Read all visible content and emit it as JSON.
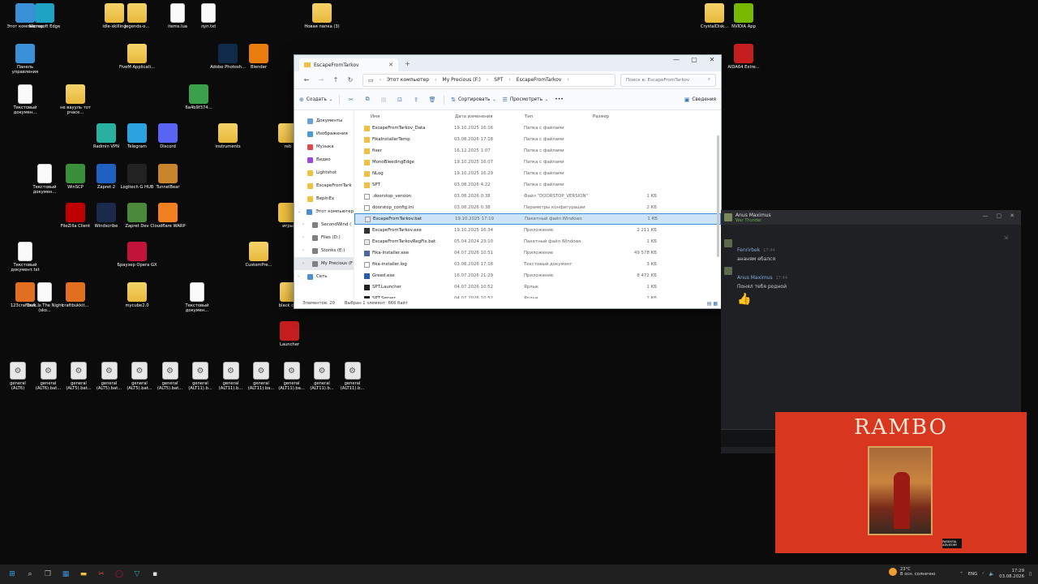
{
  "desktop": {
    "icons": [
      {
        "label": "Этот компьютер",
        "icon": "pc-icon",
        "color": "#3a8fd6",
        "kind": "app"
      },
      {
        "label": "Microsoft Edge",
        "icon": "edge-icon",
        "color": "#1fa3c4",
        "kind": "app"
      },
      {
        "label": "idle-skilling",
        "icon": "folder-icon",
        "color": "#f0c040",
        "kind": "folder"
      },
      {
        "label": "legends-o...",
        "icon": "folder-icon",
        "color": "#f0c040",
        "kind": "folder"
      },
      {
        "label": "items.lua",
        "icon": "document-icon",
        "color": "#ffffff",
        "kind": "doc"
      },
      {
        "label": "луп.txt",
        "icon": "document-icon",
        "color": "#ffffff",
        "kind": "doc"
      },
      {
        "label": "Новая папка (3)",
        "icon": "folder-icon",
        "color": "#f0c040",
        "kind": "folder"
      },
      {
        "label": "CrystalDisk...",
        "icon": "folder-icon",
        "color": "#f0c040",
        "kind": "folder"
      },
      {
        "label": "NVIDIA App",
        "icon": "nvidia-icon",
        "color": "#76b900",
        "kind": "app"
      },
      {
        "label": "Панель управления",
        "icon": "control-panel-icon",
        "color": "#3a8fd6",
        "kind": "app"
      },
      {
        "label": "FiveM Applicati...",
        "icon": "folder-icon",
        "color": "#f0c040",
        "kind": "folder"
      },
      {
        "label": "Adobe Photosh...",
        "icon": "photoshop-icon",
        "color": "#0f2a4a",
        "kind": "app"
      },
      {
        "label": "Blender",
        "icon": "blender-icon",
        "color": "#e87d0d",
        "kind": "app"
      },
      {
        "label": "AIDA64 Extre...",
        "icon": "aida64-icon",
        "color": "#c41e1e",
        "kind": "app"
      },
      {
        "label": "Текстовый докумен...",
        "icon": "document-icon",
        "color": "#ffffff",
        "kind": "doc"
      },
      {
        "label": "не ваууль тот рчасе...",
        "icon": "folder-icon",
        "color": "#f0c040",
        "kind": "folder"
      },
      {
        "label": "6a4b9f374...",
        "icon": "image-icon",
        "color": "#3aa14a",
        "kind": "app"
      },
      {
        "label": "Radmin VPN",
        "icon": "radmin-icon",
        "color": "#2ab0a0",
        "kind": "app"
      },
      {
        "label": "Telegram",
        "icon": "telegram-icon",
        "color": "#2aa3e0",
        "kind": "app"
      },
      {
        "label": "Discord",
        "icon": "discord-icon",
        "color": "#5865f2",
        "kind": "app"
      },
      {
        "label": "instruments",
        "icon": "folder-icon",
        "color": "#f0c040",
        "kind": "folder"
      },
      {
        "label": "Текстовый докумен...",
        "icon": "document-icon",
        "color": "#ffffff",
        "kind": "doc"
      },
      {
        "label": "WinSCP",
        "icon": "winscp-icon",
        "color": "#3a8f3a",
        "kind": "app"
      },
      {
        "label": "Zapret 2",
        "icon": "zapret-icon",
        "color": "#2060c0",
        "kind": "app"
      },
      {
        "label": "Logitech G HUB",
        "icon": "logitech-icon",
        "color": "#222222",
        "kind": "app"
      },
      {
        "label": "TunnelBear",
        "icon": "tunnelbear-icon",
        "color": "#c9852b",
        "kind": "app"
      },
      {
        "label": "FileZilla Client",
        "icon": "filezilla-icon",
        "color": "#bf0000",
        "kind": "app"
      },
      {
        "label": "Windscribe",
        "icon": "windscribe-icon",
        "color": "#1b2a4a",
        "kind": "app"
      },
      {
        "label": "Zapret Dev",
        "icon": "zapret-dev-icon",
        "color": "#4a8a3a",
        "kind": "app"
      },
      {
        "label": "Cloudflare WARP",
        "icon": "cloudflare-icon",
        "color": "#f38020",
        "kind": "app"
      },
      {
        "label": "Браузер Opera GX",
        "icon": "opera-icon",
        "color": "#c2143a",
        "kind": "app"
      },
      {
        "label": "CustomPre...",
        "icon": "folder-icon",
        "color": "#f0c040",
        "kind": "folder"
      },
      {
        "label": "Текстовый документ.txt",
        "icon": "document-icon",
        "color": "#ffffff",
        "kind": "doc"
      },
      {
        "label": "123craftbuk...",
        "icon": "java-icon",
        "color": "#e07020",
        "kind": "app"
      },
      {
        "label": "Dark Is The Night (sko...",
        "icon": "audio-icon",
        "color": "#ffffff",
        "kind": "doc"
      },
      {
        "label": "craftbukkit...",
        "icon": "java-icon",
        "color": "#e07020",
        "kind": "app"
      },
      {
        "label": "mycube2.0",
        "icon": "folder-icon",
        "color": "#f0c040",
        "kind": "folder"
      },
      {
        "label": "Текстовый докумен...",
        "icon": "document-icon",
        "color": "#ffffff",
        "kind": "doc"
      },
      {
        "label": "black ca...",
        "icon": "folder-icon",
        "color": "#f0c040",
        "kind": "folder"
      },
      {
        "label": "Launcher",
        "icon": "rust-edit-icon",
        "color": "#c41e1e",
        "kind": "app"
      },
      {
        "label": "игры",
        "icon": "star-icon",
        "color": "#f0c040",
        "kind": "app"
      },
      {
        "label": "reb",
        "icon": "folder-icon",
        "color": "#f0c040",
        "kind": "folder"
      },
      {
        "label": "Корзина",
        "icon": "recycle-bin-icon",
        "color": "#cfe8f7",
        "kind": "app"
      }
    ],
    "bats": [
      "general (ALT6)",
      "general (ALT6).bat...",
      "general (ALT5).bat...",
      "general (ALT5).bat...",
      "general (ALT5).bat...",
      "general (ALT5).bat...",
      "general (ALT11).b...",
      "general (ALT11).b...",
      "general (ALT11).ba...",
      "general (ALT11).ba...",
      "general (ALT11).b...",
      "general (ALT11).b..."
    ]
  },
  "explorer": {
    "tab_title": "EscapeFromTarkov",
    "breadcrumbs": [
      "Этот компьютер",
      "My Precious (F:)",
      "SPT",
      "EscapeFromTarkov"
    ],
    "search_placeholder": "Поиск в: EscapeFromTarkov",
    "toolbar": {
      "create": "Создать",
      "sort": "Сортировать",
      "view": "Просмотреть",
      "more": "•••",
      "details": "Сведения"
    },
    "sidebar": [
      {
        "label": "Документы",
        "icon": "documents-icon",
        "color": "#6aa0d8",
        "level": "pinned"
      },
      {
        "label": "Изображения",
        "icon": "pictures-icon",
        "color": "#4a9ad6",
        "level": "pinned"
      },
      {
        "label": "Музыка",
        "icon": "music-icon",
        "color": "#e04a4a",
        "level": "pinned"
      },
      {
        "label": "Видео",
        "icon": "video-icon",
        "color": "#9a4ad6",
        "level": "pinned"
      },
      {
        "label": "Lightshot",
        "icon": "folder-icon",
        "color": "#f0c040",
        "level": "pinned"
      },
      {
        "label": "EscapeFromTark",
        "icon": "folder-icon",
        "color": "#f0c040",
        "level": "pinned"
      },
      {
        "label": "BepInEx",
        "icon": "folder-icon",
        "color": "#f0c040",
        "level": "pinned"
      },
      {
        "label": "Этот компьютер",
        "icon": "pc-icon",
        "color": "#4a90d0",
        "level": "root"
      },
      {
        "label": "SecondWind (",
        "icon": "drive-icon",
        "color": "#808080",
        "level": "sub"
      },
      {
        "label": "Files (D:)",
        "icon": "drive-icon",
        "color": "#808080",
        "level": "sub"
      },
      {
        "label": "Stonks (E:)",
        "icon": "drive-icon",
        "color": "#808080",
        "level": "sub"
      },
      {
        "label": "My Precious (F",
        "icon": "drive-icon",
        "color": "#808080",
        "level": "sub-active"
      },
      {
        "label": "Сеть",
        "icon": "network-icon",
        "color": "#4a90d0",
        "level": "root"
      }
    ],
    "columns": {
      "name": "Имя",
      "date": "Дата изменения",
      "type": "Тип",
      "size": "Размер"
    },
    "files": [
      {
        "name": "EscapeFromTarkov_Data",
        "date": "19.10.2025 16:16",
        "type": "Папка с файлами",
        "size": "",
        "icon": "folder-icon",
        "color": "#f0c040"
      },
      {
        "name": "FikaInstallerTemp",
        "date": "03.08.2026 17:18",
        "type": "Папка с файлами",
        "size": "",
        "icon": "folder-icon",
        "color": "#f0c040"
      },
      {
        "name": "fixer",
        "date": "16.12.2025 1:07",
        "type": "Папка с файлами",
        "size": "",
        "icon": "folder-icon",
        "color": "#f0c040"
      },
      {
        "name": "MonoBleedingEdge",
        "date": "19.10.2025 16:07",
        "type": "Папка с файлами",
        "size": "",
        "icon": "folder-icon",
        "color": "#f0c040"
      },
      {
        "name": "NLog",
        "date": "19.10.2025 16:29",
        "type": "Папка с файлами",
        "size": "",
        "icon": "folder-icon",
        "color": "#f0c040"
      },
      {
        "name": "SPT",
        "date": "03.08.2026 4:22",
        "type": "Папка с файлами",
        "size": "",
        "icon": "folder-icon",
        "color": "#f0c040"
      },
      {
        "name": ".doorstop_version",
        "date": "03.08.2026 0:38",
        "type": "Файл \"DOORSTOP_VERSION\"",
        "size": "1 КБ",
        "icon": "file-icon",
        "color": "#ffffff"
      },
      {
        "name": "doorstop_config.ini",
        "date": "03.08.2026 0:38",
        "type": "Параметры конфигурации",
        "size": "2 КБ",
        "icon": "config-file-icon",
        "color": "#ffffff"
      },
      {
        "name": "EscapeFromTarkov.bat",
        "date": "19.10.2025 17:19",
        "type": "Пакетный файл Windows",
        "size": "1 КБ",
        "icon": "bat-file-icon",
        "color": "#e8e8e8"
      },
      {
        "name": "EscapeFromTarkov.exe",
        "date": "19.10.2025 16:34",
        "type": "Приложение",
        "size": "2 211 КБ",
        "icon": "exe-icon",
        "color": "#333333"
      },
      {
        "name": "EscapeFromTarkovRegFix.bat",
        "date": "05.04.2024 23:10",
        "type": "Пакетный файл Windows",
        "size": "1 КБ",
        "icon": "bat-file-icon",
        "color": "#e8e8e8"
      },
      {
        "name": "Fika-Installer.exe",
        "date": "04.07.2026 10:51",
        "type": "Приложение",
        "size": "49 578 КБ",
        "icon": "exe-icon",
        "color": "#4a6aa0"
      },
      {
        "name": "fika-installer.log",
        "date": "03.08.2026 17:18",
        "type": "Текстовый документ",
        "size": "3 КБ",
        "icon": "text-file-icon",
        "color": "#ffffff"
      },
      {
        "name": "Greed.exe",
        "date": "16.07.2026 21:29",
        "type": "Приложение",
        "size": "8 472 КБ",
        "icon": "exe-icon",
        "color": "#2a5ab0"
      },
      {
        "name": "SPT.Launcher",
        "date": "04.07.2026 10:52",
        "type": "Ярлык",
        "size": "1 КБ",
        "icon": "shortcut-icon",
        "color": "#222222"
      },
      {
        "name": "SPT.Server",
        "date": "04.07.2026 10:52",
        "type": "Ярлык",
        "size": "1 КБ",
        "icon": "shortcut-icon",
        "color": "#222222"
      }
    ],
    "selected_index": 8,
    "status_count": "Элементов: 20",
    "status_selected": "Выбран 1 элемент: 666 байт"
  },
  "chat": {
    "header_name": "Anus Maximus",
    "header_game": "War Thunder",
    "messages": [
      {
        "author": "Fenrirbek",
        "time": "17:44",
        "text": "ананям ебался",
        "author_color": "#8aa8d8"
      },
      {
        "author": "Anus Maximus",
        "time": "17:44",
        "text": "Понял тебя родной",
        "author_color": "#7fb0e0"
      }
    ]
  },
  "album": {
    "title": "RAMBO",
    "advisory": "PARENTAL ADVISORY",
    "bg_color": "#d8361f"
  },
  "taskbar": {
    "apps": [
      "start-icon",
      "search-icon",
      "taskview-icon",
      "widgets-icon",
      "explorer-icon",
      "snipping-icon",
      "opera-icon",
      "radmin-icon",
      "spt-icon"
    ],
    "weather_temp": "23°C",
    "weather_desc": "В осн. солнечно",
    "lang": "ENG",
    "time": "17:29",
    "date": "03.08.2026"
  }
}
